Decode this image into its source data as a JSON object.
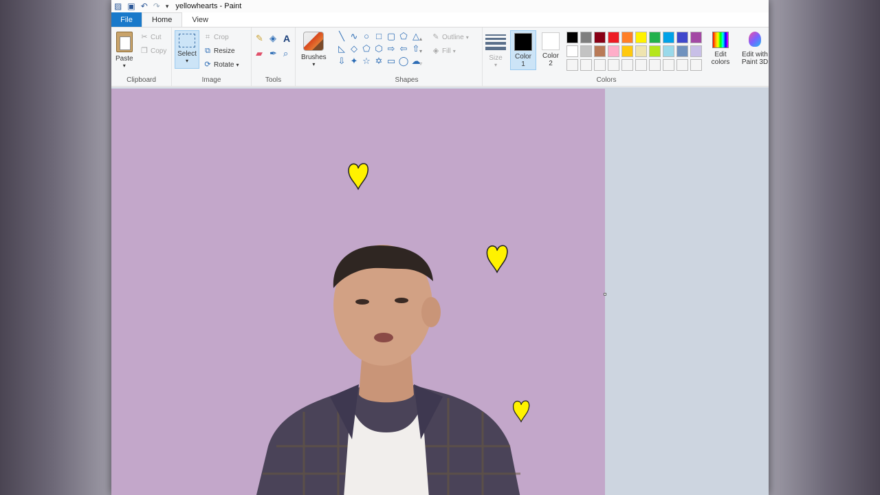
{
  "window": {
    "title": "yellowhearts - Paint"
  },
  "tabs": [
    {
      "label": "File"
    },
    {
      "label": "Home"
    },
    {
      "label": "View"
    }
  ],
  "clipboard": {
    "paste": "Paste",
    "cut": "Cut",
    "copy": "Copy",
    "group": "Clipboard"
  },
  "image": {
    "select": "Select",
    "crop": "Crop",
    "resize": "Resize",
    "rotate": "Rotate",
    "group": "Image"
  },
  "tools": {
    "group": "Tools"
  },
  "brushes": {
    "label": "Brushes"
  },
  "shapes": {
    "outline": "Outline",
    "fill": "Fill",
    "group": "Shapes"
  },
  "size": {
    "label": "Size"
  },
  "colors": {
    "color1_label": "Color 1",
    "color2_label": "Color 2",
    "color1": "#000000",
    "color2": "#ffffff",
    "edit_colors": "Edit colors",
    "edit_paint3d": "Edit with Paint 3D",
    "group": "Colors",
    "palette": [
      "#000000",
      "#7f7f7f",
      "#880015",
      "#ed1c24",
      "#ff7f27",
      "#fff200",
      "#22b14c",
      "#00a2e8",
      "#3f48cc",
      "#a349a4",
      "#ffffff",
      "#c3c3c3",
      "#b97a57",
      "#ffaec9",
      "#ffc90e",
      "#efe4b0",
      "#b5e61d",
      "#99d9ea",
      "#7092be",
      "#c8bfe7",
      "#f5f5f5",
      "#f5f5f5",
      "#f5f5f5",
      "#f5f5f5",
      "#f5f5f5",
      "#f5f5f5",
      "#f5f5f5",
      "#f5f5f5",
      "#f5f5f5",
      "#f5f5f5"
    ]
  },
  "canvas": {
    "background": "#c3a7ca",
    "heart_color": "#fff200"
  }
}
